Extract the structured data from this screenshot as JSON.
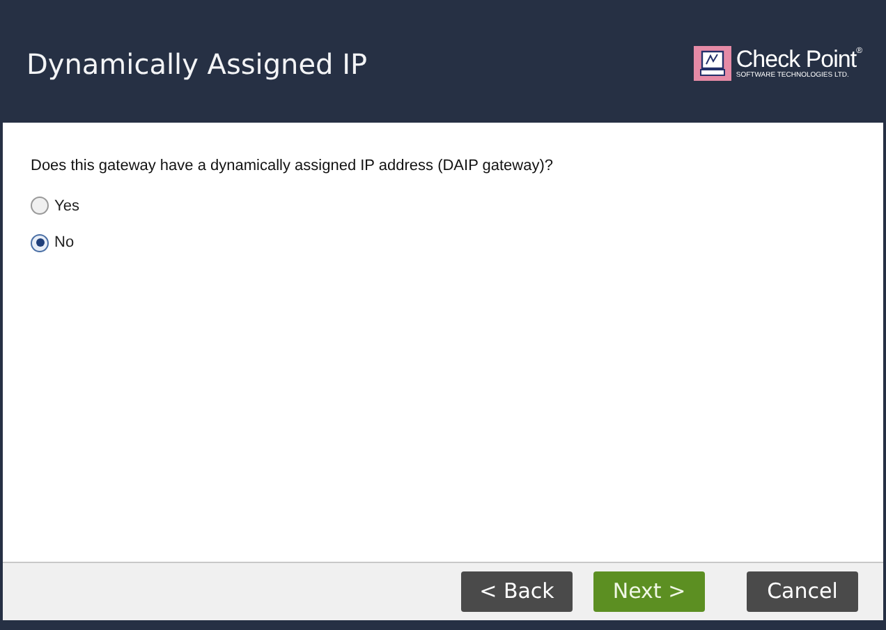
{
  "header": {
    "title": "Dynamically Assigned IP",
    "logo": {
      "name": "Check Point",
      "mark": "®",
      "tagline": "SOFTWARE TECHNOLOGIES LTD."
    }
  },
  "question": "Does this gateway have a dynamically assigned IP address (DAIP gateway)?",
  "options": [
    {
      "label": "Yes",
      "selected": false
    },
    {
      "label": "No",
      "selected": true
    }
  ],
  "buttons": [
    {
      "label": "< Back",
      "kind": "secondary"
    },
    {
      "label": "Next >",
      "kind": "primary"
    },
    {
      "label": "Cancel",
      "kind": "secondary"
    }
  ]
}
